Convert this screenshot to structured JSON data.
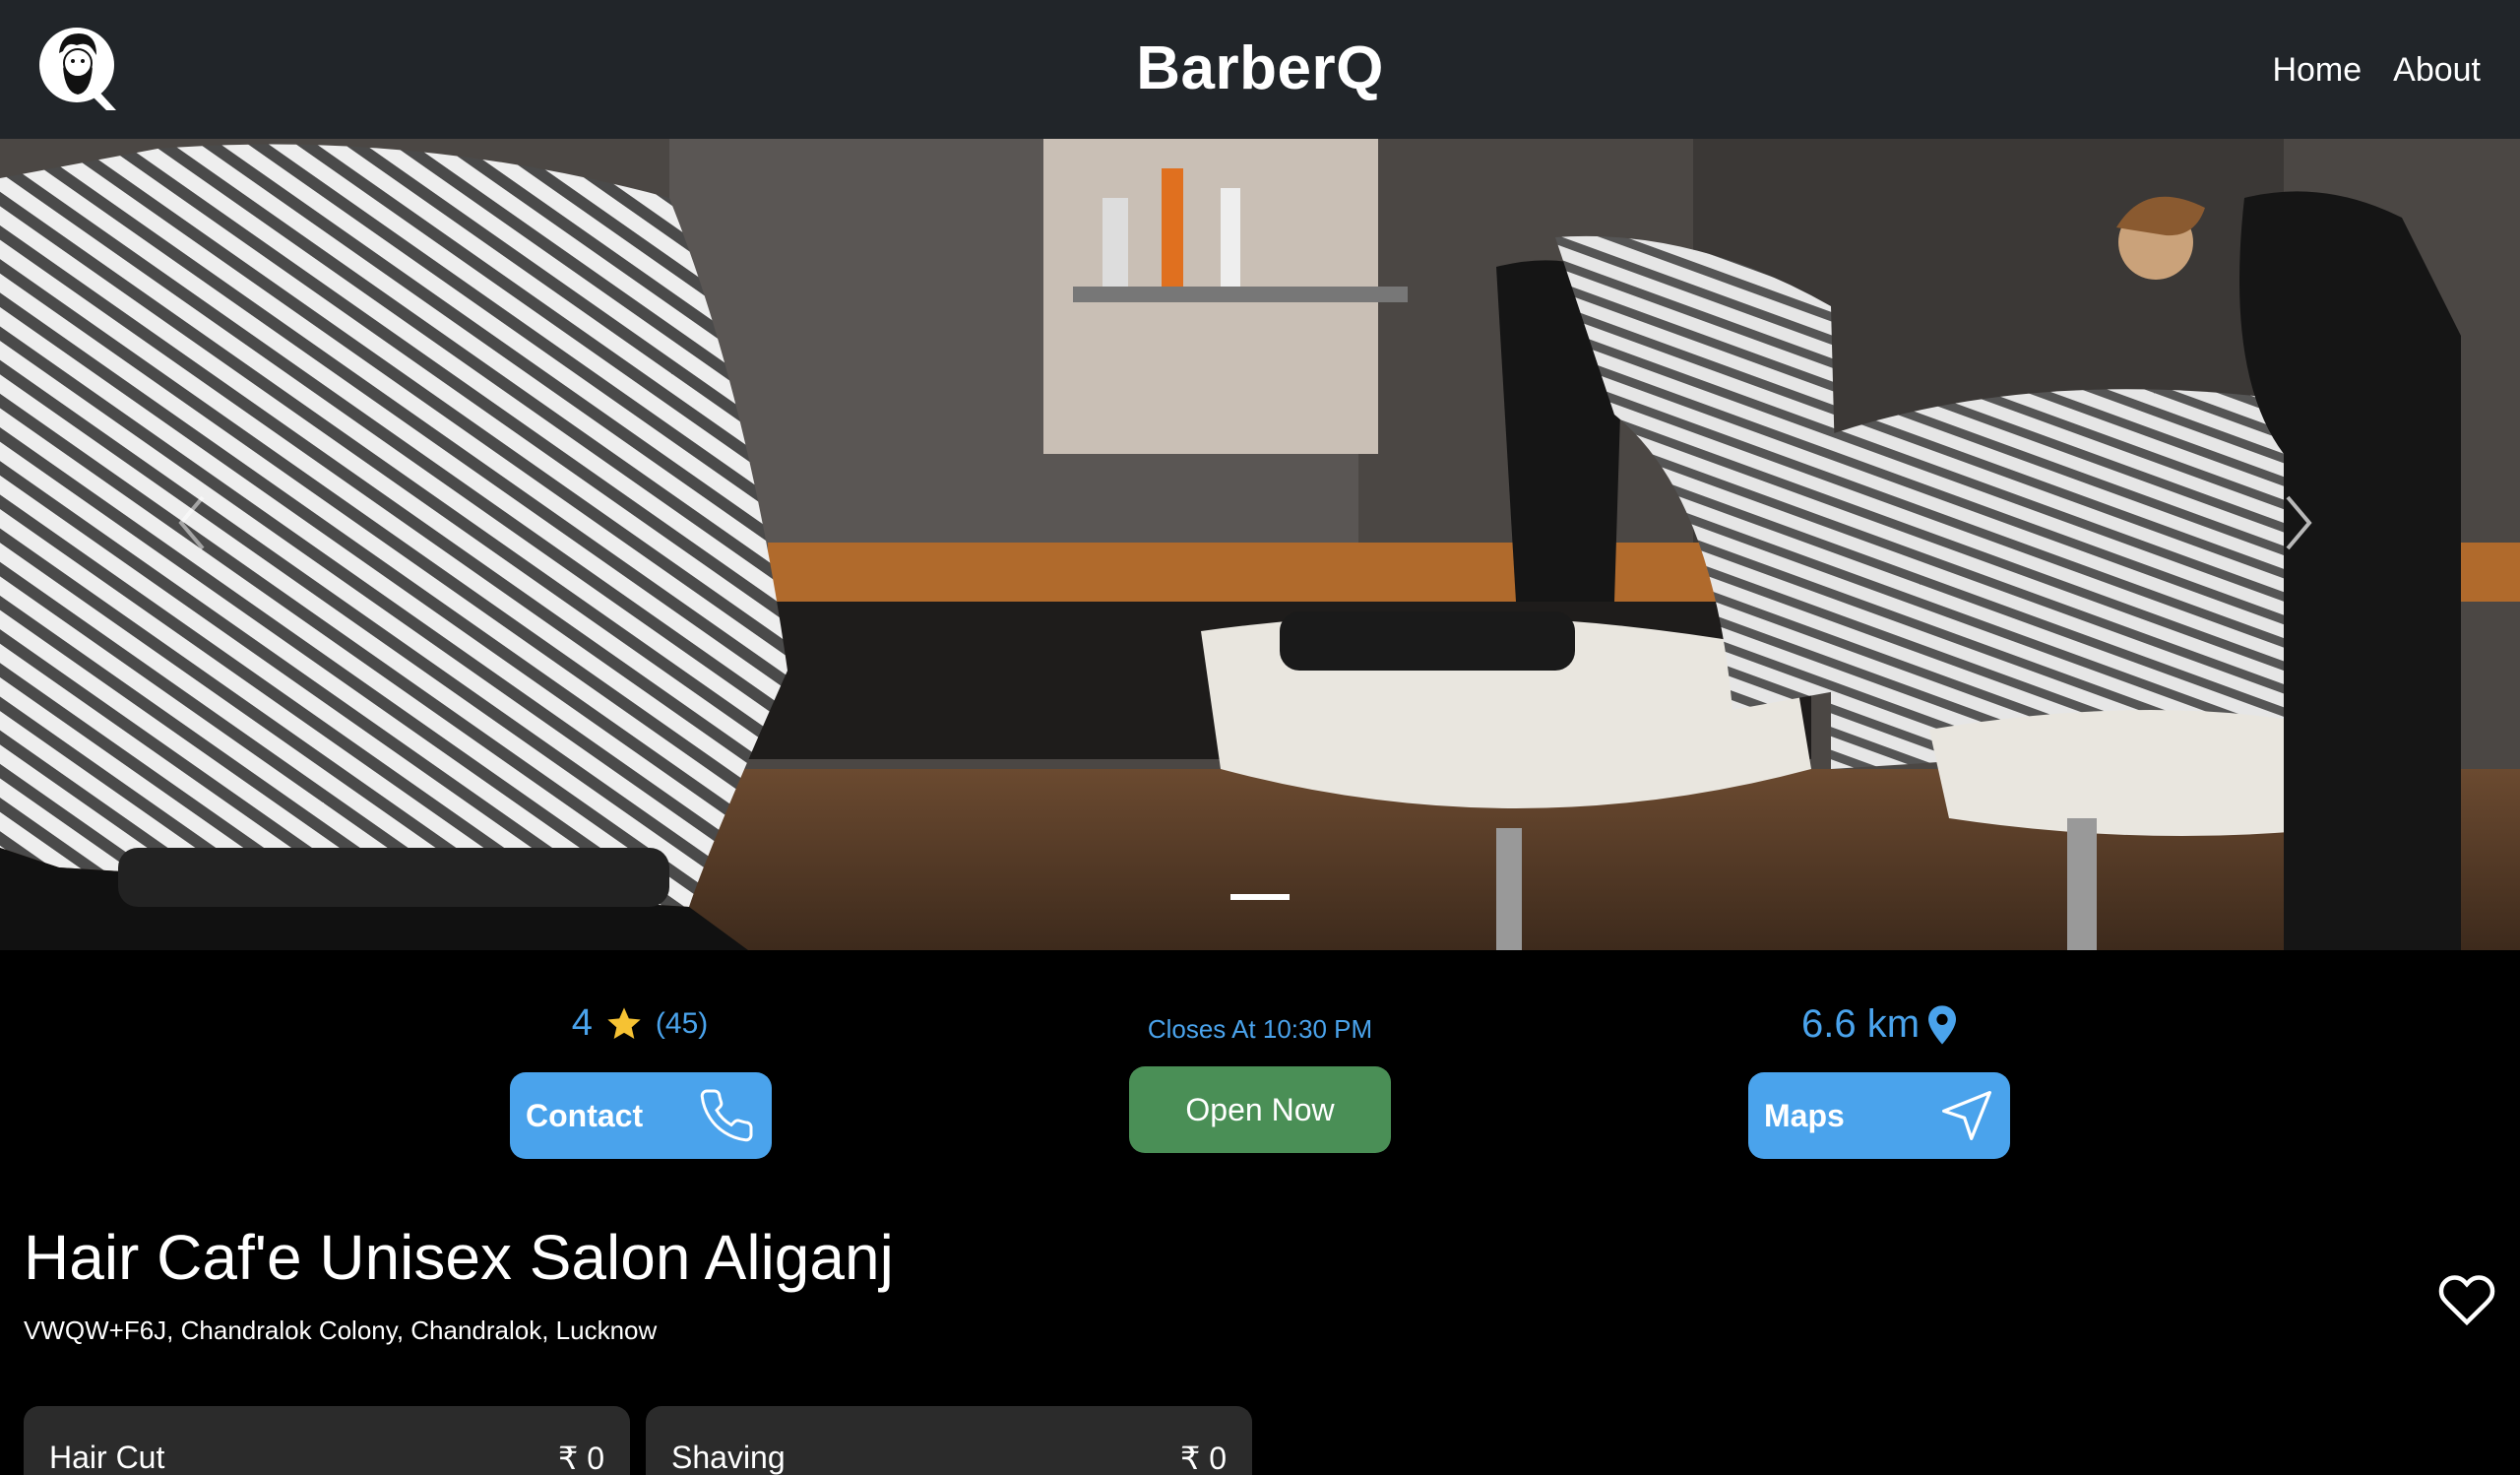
{
  "header": {
    "brand": "BarberQ",
    "logo_icon": "barber-face-q-logo",
    "nav": [
      {
        "label": "Home"
      },
      {
        "label": "About"
      }
    ],
    "background": "#212529"
  },
  "carousel": {
    "indicator_count": 1,
    "active_index": 0
  },
  "info": {
    "rating": "4",
    "rating_icon": "star-icon",
    "rating_count": "(45)",
    "closes": "Closes At 10:30 PM",
    "distance": "6.6 km",
    "distance_icon": "location-pin-icon",
    "accent": "#4aa3ec",
    "open_color": "#4a8f56"
  },
  "buttons": {
    "contact": "Contact",
    "open": "Open Now",
    "maps": "Maps"
  },
  "salon": {
    "name": "Hair Caf'e Unisex Salon Aliganj",
    "address": "VWQW+F6J, Chandralok Colony, Chandralok, Lucknow"
  },
  "services": [
    {
      "name": "Hair Cut",
      "price": "₹ 0"
    },
    {
      "name": "Shaving",
      "price": "₹ 0"
    }
  ]
}
